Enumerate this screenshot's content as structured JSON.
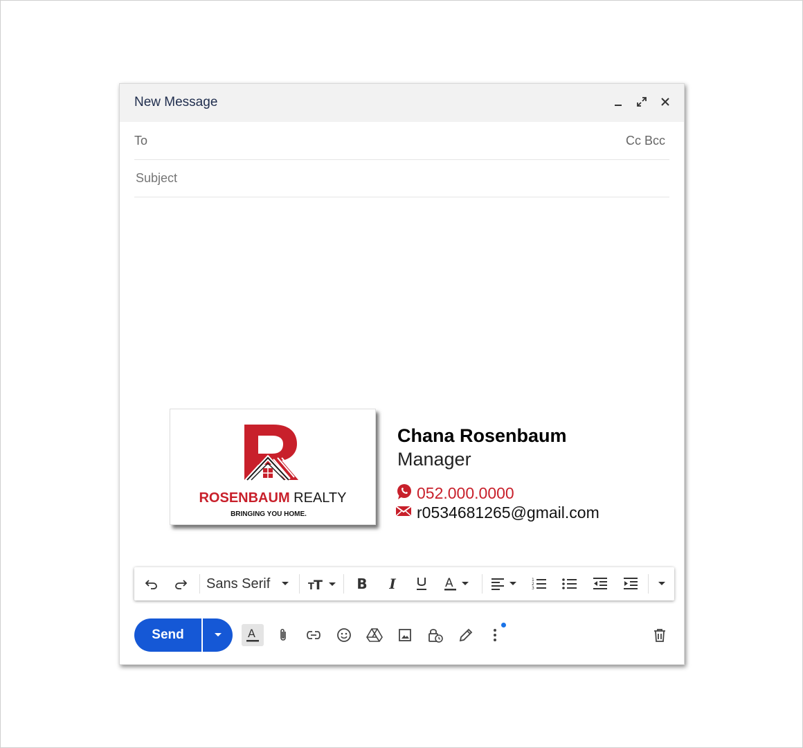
{
  "window": {
    "title": "New Message",
    "controls": [
      "minimize-icon",
      "expand-icon",
      "close-icon"
    ]
  },
  "fields": {
    "to_label": "To",
    "cc_bcc": "Cc Bcc",
    "to_value": "",
    "subject_placeholder": "Subject",
    "subject_value": ""
  },
  "signature": {
    "logo": {
      "brand_main": "ROSENBAUM",
      "brand_second": "REALTY",
      "tagline": "BRINGING YOU HOME."
    },
    "name": "Chana Rosenbaum",
    "role": "Manager",
    "phone": "052.000.0000",
    "email": "r0534681265@gmail.com",
    "colors": {
      "accent": "#c8202b",
      "text": "#111111"
    }
  },
  "format_toolbar": {
    "font_family": "Sans Serif",
    "icons": [
      "undo-icon",
      "redo-icon",
      "font-size-icon",
      "bold-icon",
      "italic-icon",
      "underline-icon",
      "text-color-icon",
      "align-icon",
      "numbered-list-icon",
      "bulleted-list-icon",
      "indent-less-icon",
      "indent-more-icon",
      "more-formatting-icon"
    ]
  },
  "bottom_toolbar": {
    "send_label": "Send",
    "icons": [
      "formatting-toggle-icon",
      "attach-icon",
      "link-icon",
      "emoji-icon",
      "drive-icon",
      "photo-icon",
      "confidential-icon",
      "signature-icon",
      "more-options-icon",
      "discard-icon"
    ],
    "accent": "#1558d6"
  }
}
